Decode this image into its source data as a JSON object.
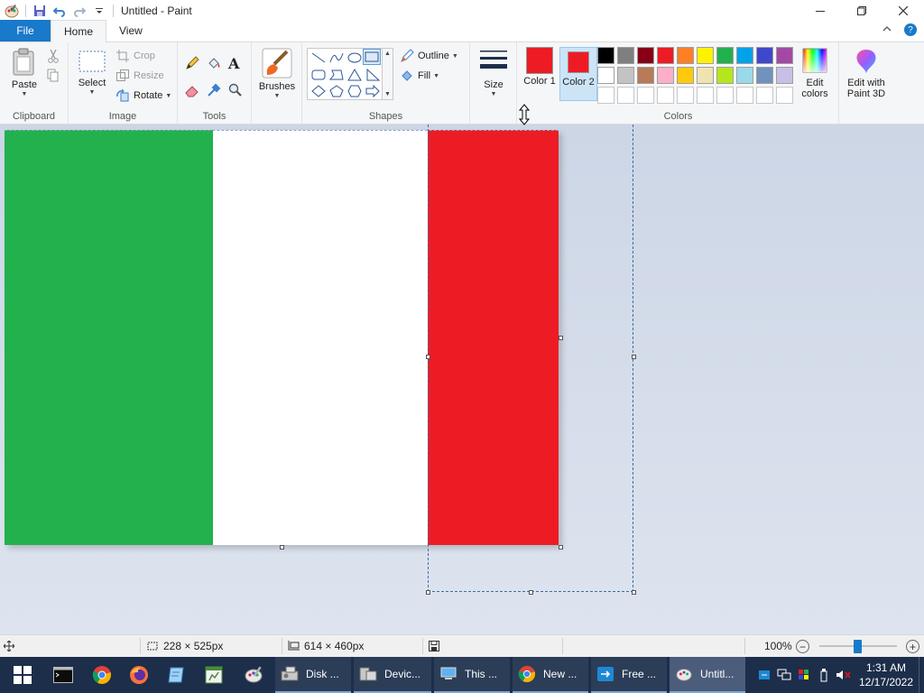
{
  "window": {
    "title": "Untitled - Paint"
  },
  "tabs": {
    "file": "File",
    "home": "Home",
    "view": "View"
  },
  "ribbon": {
    "clipboard": {
      "label": "Clipboard",
      "paste": "Paste"
    },
    "image": {
      "label": "Image",
      "select": "Select",
      "crop": "Crop",
      "resize": "Resize",
      "rotate": "Rotate"
    },
    "tools": {
      "label": "Tools"
    },
    "brushes": {
      "label": "Brushes"
    },
    "shapes": {
      "label": "Shapes",
      "outline": "Outline",
      "fill": "Fill"
    },
    "size": {
      "label": "Size"
    },
    "colors": {
      "label": "Colors",
      "color1_label": "Color 1",
      "color2_label": "Color 2",
      "color1": "#ed1c24",
      "color2": "#ed1c24",
      "edit_colors": "Edit colors",
      "palette_row1": [
        "#000000",
        "#7f7f7f",
        "#880015",
        "#ed1c24",
        "#ff7f27",
        "#fff200",
        "#22b14c",
        "#00a2e8",
        "#3f48cc",
        "#a349a4"
      ],
      "palette_row2": [
        "#ffffff",
        "#c3c3c3",
        "#b97a57",
        "#ffaec9",
        "#ffc90e",
        "#efe4b0",
        "#b5e61d",
        "#99d9ea",
        "#7092be",
        "#c8bfe7"
      ]
    },
    "paint3d": "Edit with Paint 3D"
  },
  "canvas": {
    "stripe_colors": [
      "#22b14c",
      "#ffffff",
      "#ed1c24"
    ]
  },
  "statusbar": {
    "selection_size": "228 × 525px",
    "image_size": "614 × 460px",
    "zoom": "100%"
  },
  "taskbar": {
    "apps": [
      "Disk ...",
      "Devic...",
      "This ...",
      "New ...",
      "Free ...",
      "Untitl..."
    ],
    "time": "1:31 AM",
    "date": "12/17/2022"
  }
}
